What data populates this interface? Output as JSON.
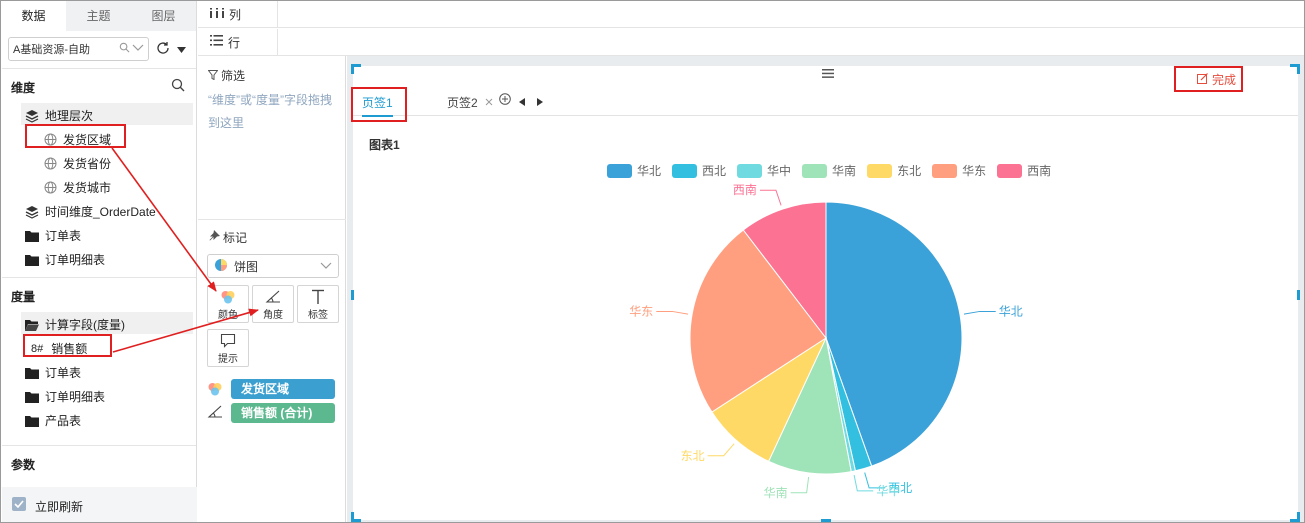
{
  "left_panel": {
    "tabs": [
      "数据",
      "主题",
      "图层"
    ],
    "datasource": "A基础资源-自助",
    "dimensions": {
      "title": "维度",
      "items": [
        {
          "label": "地理层次",
          "icon": "layers-icon"
        },
        {
          "label": "发货区域",
          "icon": "globe-icon"
        },
        {
          "label": "发货省份",
          "icon": "globe-icon"
        },
        {
          "label": "发货城市",
          "icon": "globe-icon"
        },
        {
          "label": "时间维度_OrderDate",
          "icon": "layers-icon"
        },
        {
          "label": "订单表",
          "icon": "folder-icon"
        },
        {
          "label": "订单明细表",
          "icon": "folder-icon"
        }
      ]
    },
    "measures": {
      "title": "度量",
      "items": [
        {
          "label": "计算字段(度量)",
          "icon": "folder-open-icon"
        },
        {
          "label": "销售额",
          "icon": "number-field-icon",
          "prefix": "8#"
        },
        {
          "label": "订单表",
          "icon": "folder-icon"
        },
        {
          "label": "订单明细表",
          "icon": "folder-icon"
        },
        {
          "label": "产品表",
          "icon": "folder-icon"
        }
      ]
    },
    "params_title": "参数",
    "refresh_label": "立即刷新"
  },
  "top": {
    "columns_label": "列",
    "rows_label": "行"
  },
  "mid_panel": {
    "filter_title": "筛选",
    "filter_hint": "“维度”或“度量”字段拖拽到这里",
    "marks_title": "标记",
    "chart_type": "饼图",
    "mark_buttons": [
      {
        "label": "颜色",
        "icon": "color-icon"
      },
      {
        "label": "角度",
        "icon": "angle-icon"
      },
      {
        "label": "标签",
        "icon": "text-icon"
      },
      {
        "label": "提示",
        "icon": "tooltip-icon"
      }
    ],
    "color_field": "发货区域",
    "angle_field": "销售额 (合计)",
    "pill_colors": {
      "color": "#3ba0d0",
      "angle": "#5cb88f"
    }
  },
  "canvas": {
    "done_label": "完成",
    "page_tabs": [
      "页签1",
      "页签2"
    ],
    "chart_title": "图表1"
  },
  "chart_data": {
    "type": "pie",
    "title": "图表1",
    "legend_position": "top",
    "categories": [
      "华北",
      "西北",
      "华中",
      "华南",
      "东北",
      "华东",
      "西南"
    ],
    "values": [
      45,
      2,
      0.5,
      10,
      9,
      24,
      10.5
    ],
    "colors": [
      "#3ba2d9",
      "#33c0e0",
      "#6fdbe0",
      "#9fe3b8",
      "#ffd966",
      "#ff9f7f",
      "#fb7293"
    ]
  }
}
